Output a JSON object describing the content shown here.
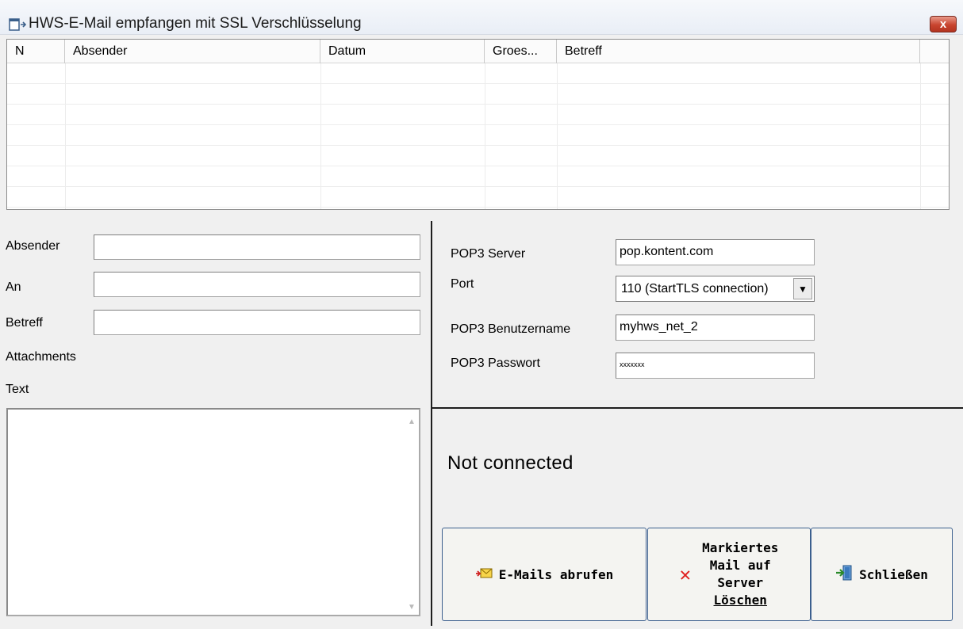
{
  "window": {
    "title": "HWS-E-Mail empfangen mit SSL Verschlüsselung",
    "close_label": "x"
  },
  "mail_list": {
    "columns": [
      "N",
      "Absender",
      "Datum",
      "Groes...",
      "Betreff"
    ],
    "rows": []
  },
  "message": {
    "sender_label": "Absender",
    "sender_value": "",
    "to_label": "An",
    "to_value": "",
    "subject_label": "Betreff",
    "subject_value": "",
    "attachments_label": "Attachments",
    "text_label": "Text",
    "text_value": ""
  },
  "pop3": {
    "server_label": "POP3 Server",
    "server_value": "pop.kontent.com",
    "port_label": "Port",
    "port_value": "110 (StartTLS connection)",
    "user_label": "POP3 Benutzername",
    "user_value": "myhws_net_2",
    "password_label": "POP3 Passwort",
    "password_value": "xxxxxxx"
  },
  "status": {
    "text": "Not connected"
  },
  "buttons": {
    "fetch_label": "E-Mails abrufen",
    "delete_line1": "Markiertes",
    "delete_line2": "Mail auf",
    "delete_line3": "Server",
    "delete_line4": "Löschen",
    "close_label": "Schließen"
  },
  "icons": {
    "title": "app-window-icon",
    "fetch": "envelope-arrow-icon",
    "delete": "red-x-icon",
    "close": "exit-door-icon"
  },
  "colors": {
    "close_button": "#c8442f",
    "button_border": "#3b5f8e",
    "delete_icon": "#e02020"
  }
}
